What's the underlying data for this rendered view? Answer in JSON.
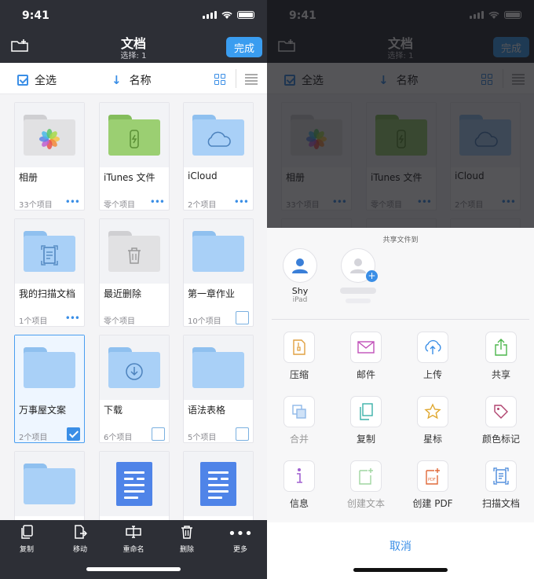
{
  "status": {
    "time": "9:41"
  },
  "header": {
    "title": "文档",
    "subtitle": "选择: 1",
    "done_label": "完成"
  },
  "sortbar": {
    "select_all": "全选",
    "sort_label": "名称"
  },
  "items": [
    {
      "name": "相册",
      "count": "33个项目",
      "kind": "photos",
      "control": "more"
    },
    {
      "name": "iTunes 文件",
      "count": "零个项目",
      "kind": "itunes",
      "control": "more"
    },
    {
      "name": "iCloud",
      "count": "2个项目",
      "kind": "icloud",
      "control": "more"
    },
    {
      "name": "我的扫描文档",
      "count": "1个项目",
      "kind": "scan",
      "control": "more"
    },
    {
      "name": "最近删除",
      "count": "零个项目",
      "kind": "trash",
      "control": "none"
    },
    {
      "name": "第一章作业",
      "count": "10个项目",
      "kind": "folder",
      "control": "check"
    },
    {
      "name": "万事屋文案",
      "count": "2个项目",
      "kind": "folder",
      "control": "checked"
    },
    {
      "name": "下载",
      "count": "6个项目",
      "kind": "download",
      "control": "check"
    },
    {
      "name": "语法表格",
      "count": "5个项目",
      "kind": "folder",
      "control": "check"
    },
    {
      "name": "",
      "count": "",
      "kind": "folder",
      "control": "none"
    },
    {
      "name": "",
      "count": "",
      "kind": "doc",
      "control": "none"
    },
    {
      "name": "",
      "count": "",
      "kind": "doc",
      "control": "none"
    }
  ],
  "toolbar": [
    {
      "label": "复制",
      "icon": "copy-icon"
    },
    {
      "label": "移动",
      "icon": "move-icon"
    },
    {
      "label": "重命名",
      "icon": "rename-icon"
    },
    {
      "label": "删除",
      "icon": "trash-icon"
    },
    {
      "label": "更多",
      "icon": "more-icon"
    }
  ],
  "share": {
    "title": "共享文件到",
    "contacts": [
      {
        "name": "Shy",
        "device": "iPad"
      }
    ],
    "actions": [
      {
        "label": "压缩",
        "icon": "zip-icon",
        "enabled": true
      },
      {
        "label": "邮件",
        "icon": "mail-icon",
        "enabled": true
      },
      {
        "label": "上传",
        "icon": "cloud-upload-icon",
        "enabled": true
      },
      {
        "label": "共享",
        "icon": "share-icon",
        "enabled": true
      },
      {
        "label": "合并",
        "icon": "merge-icon",
        "enabled": false
      },
      {
        "label": "复制",
        "icon": "duplicate-icon",
        "enabled": true
      },
      {
        "label": "星标",
        "icon": "star-icon",
        "enabled": true
      },
      {
        "label": "颜色标记",
        "icon": "tag-icon",
        "enabled": true
      },
      {
        "label": "信息",
        "icon": "info-icon",
        "enabled": true
      },
      {
        "label": "创建文本",
        "icon": "create-text-icon",
        "enabled": false
      },
      {
        "label": "创建 PDF",
        "icon": "create-pdf-icon",
        "enabled": true
      },
      {
        "label": "扫描文档",
        "icon": "scan-doc-icon",
        "enabled": true
      }
    ],
    "cancel_label": "取消"
  },
  "colors": {
    "accent": "#3a8ee6",
    "topbar": "#2d2f36",
    "folder_blue": "#a9d0f7",
    "folder_green": "#9bcf72",
    "folder_gray": "#dcdcdc"
  }
}
